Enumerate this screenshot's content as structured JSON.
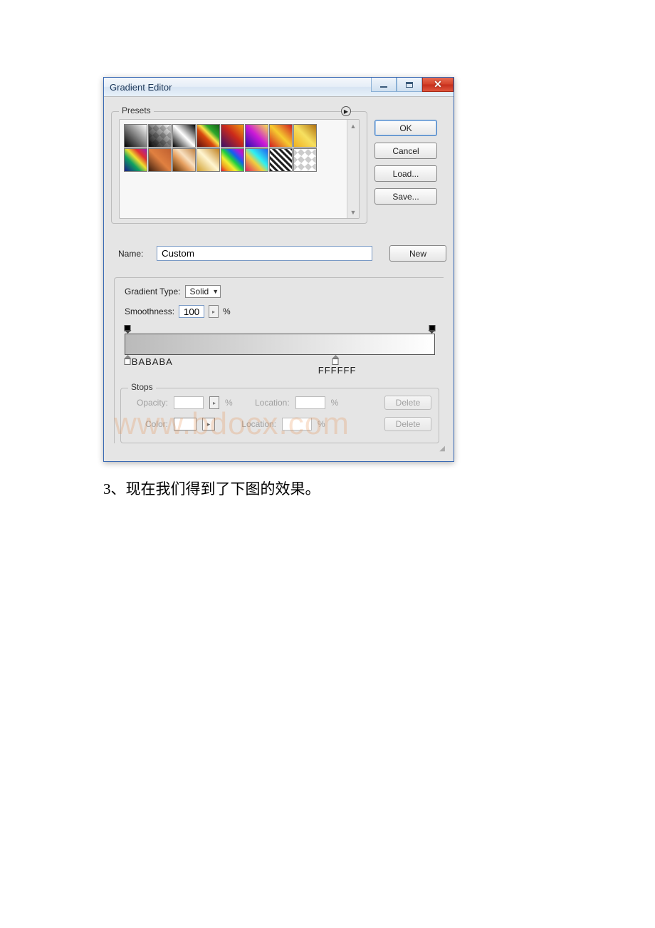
{
  "window": {
    "title": "Gradient Editor"
  },
  "side_buttons": {
    "ok": "OK",
    "cancel": "Cancel",
    "load": "Load...",
    "save": "Save..."
  },
  "presets": {
    "legend": "Presets"
  },
  "name": {
    "label": "Name:",
    "value": "Custom",
    "new_btn": "New"
  },
  "editor": {
    "gradient_type_label": "Gradient Type:",
    "gradient_type_value": "Solid",
    "smoothness_label": "Smoothness:",
    "smoothness_value": "100",
    "percent": "%"
  },
  "gradient_stops": {
    "left_label": "BABABA",
    "left_color": "#bababa",
    "left_pos_pct": 0,
    "mid_label": "FFFFFF",
    "mid_pos_pct": 68,
    "right_color": "#000000",
    "right_pos_pct": 100
  },
  "stops": {
    "legend": "Stops",
    "opacity_label": "Opacity:",
    "location_label": "Location:",
    "color_label": "Color:",
    "percent": "%",
    "delete": "Delete"
  },
  "watermark": "www.bdocx.com",
  "caption": "3、现在我们得到了下图的效果。"
}
